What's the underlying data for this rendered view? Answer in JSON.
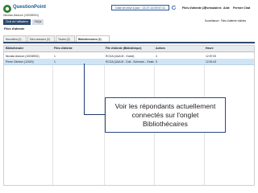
{
  "header": {
    "logo_text": "QuestionPoint",
    "refresh_label": "Date de mise à jour : 13-07-16 09:57:11",
    "nav_waiting": "Files d'attente (2)",
    "nav_forms": "Formulaires",
    "nav_help": "Aide",
    "nav_close": "Fermer Chat",
    "nav_sub": "Surveillance : Files d'attente visibles",
    "user": "Nicolas Alarcon (10038931)"
  },
  "mode_tabs": [
    {
      "label": "Chat de l'utilisateur"
    },
    {
      "label": "FAQs"
    }
  ],
  "panel": {
    "title": "Files d'attente",
    "subtabs": [
      {
        "label": "Nouvelles (0)"
      },
      {
        "label": "Mes sessions (0)"
      },
      {
        "label": "Toutes (0)"
      },
      {
        "label": "Bibliothécaires (2)"
      }
    ]
  },
  "table": {
    "columns": [
      "Bibliothécaire",
      "Files d'attente",
      "File d'attente (Bibliothèque)",
      "Actives",
      "Heure"
    ],
    "rows": [
      [
        "Nicolas Alarcon (10038931)",
        "1",
        "RCGA (U&A M - Ouest)",
        "4",
        "12:57:05"
      ],
      [
        "Pierre Gérinier (12020)",
        "1",
        "RCGA (U&A M - Doit - Sciences - Gestion)",
        "5",
        "12:51:43"
      ]
    ]
  },
  "callout": {
    "text": "Voir les répondants actuellement connectés sur l'onglet Bibliothécaires"
  },
  "colors": {
    "accent": "#2d4a6e",
    "selected_row": "#cfe4f5",
    "callout_border": "#2a4b80"
  }
}
